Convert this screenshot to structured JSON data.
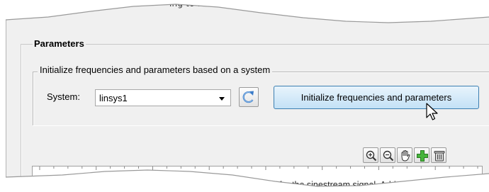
{
  "top_fragment": "ing to ...",
  "parameters": {
    "title": "Parameters",
    "init_group": {
      "title": "Initialize frequencies and parameters based on a system",
      "system_label": "System:",
      "system_value": "linsys1",
      "refresh_icon": "refresh-icon",
      "init_button_label": "Initialize frequencies and parameters"
    },
    "toolbar": {
      "icons": [
        "zoom-in-icon",
        "zoom-out-icon",
        "pan-hand-icon",
        "add-icon",
        "delete-icon"
      ]
    },
    "hint_text": "for the sinestream signal. Add"
  },
  "colors": {
    "panel_bg": "#f0f0f0",
    "primary_button_border": "#3c7fb1",
    "add_icon_green": "#3ea83a"
  }
}
